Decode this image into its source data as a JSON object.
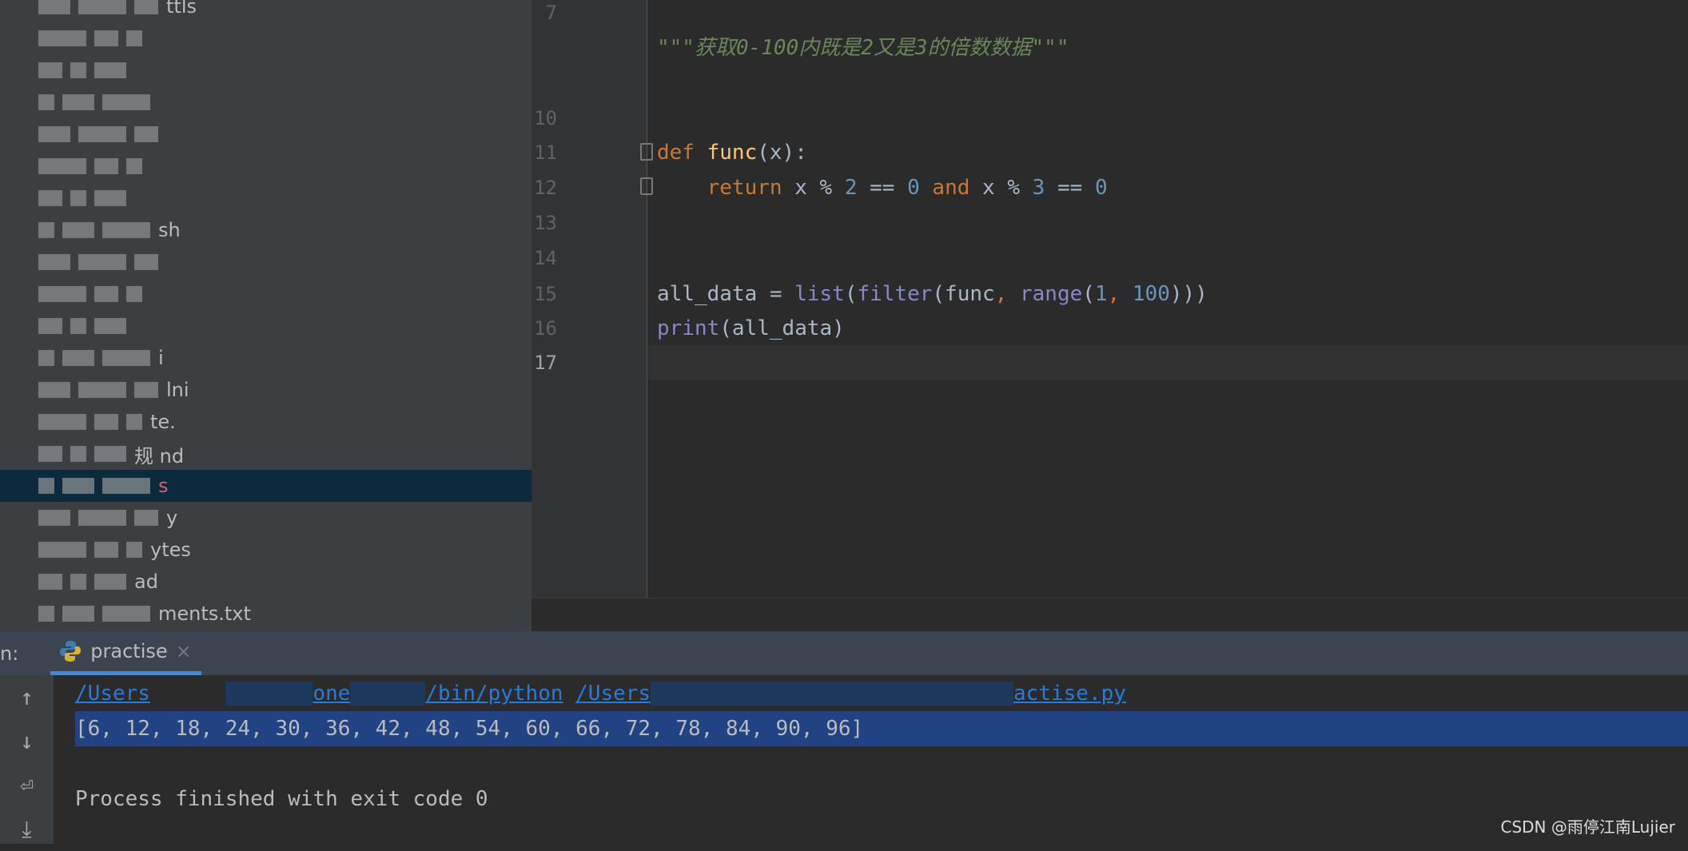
{
  "sidebar": {
    "items": [
      {
        "label": "ttls"
      },
      {
        "label": ""
      },
      {
        "label": ""
      },
      {
        "label": ""
      },
      {
        "label": ""
      },
      {
        "label": ""
      },
      {
        "label": ""
      },
      {
        "label": "sh"
      },
      {
        "label": ""
      },
      {
        "label": ""
      },
      {
        "label": ""
      },
      {
        "label": "i"
      },
      {
        "label": "lni"
      },
      {
        "label": "te."
      },
      {
        "label": "规  nd"
      },
      {
        "label": "s"
      },
      {
        "label": "y"
      },
      {
        "label": "ytes"
      },
      {
        "label": "ad"
      },
      {
        "label": "ments.txt"
      }
    ],
    "selected_index": 15
  },
  "editor": {
    "line_numbers": [
      "7",
      "",
      "",
      "10",
      "11",
      "12",
      "13",
      "14",
      "15",
      "16",
      "17"
    ],
    "current_line": "17",
    "docstring": "\"\"\"获取0-100内既是2又是3的倍数数据\"\"\"",
    "lines": {
      "l11": {
        "kw": "def",
        "fn": "func",
        "rest": "(x):"
      },
      "l12": {
        "kw1": "return",
        "a": " x % ",
        "n1": "2",
        "b": " == ",
        "n2": "0",
        "kw2": "and",
        "c": " x % ",
        "n3": "3",
        "d": " == ",
        "n4": "0"
      },
      "l15": {
        "a": "all_data = ",
        "b1": "list",
        "p1": "(",
        "b2": "filter",
        "p2": "(func",
        "comma1": ",",
        "sp": " ",
        "b3": "range",
        "p3": "(",
        "n1": "1",
        "comma2": ",",
        "n2": "100",
        "p4": ")))"
      },
      "l16": {
        "b": "print",
        "rest": "(all_data)"
      }
    }
  },
  "run_panel": {
    "label": "n:",
    "tab_label": "practise",
    "close_icon": "×",
    "command": {
      "p1": "/Users",
      "p2": "one",
      "p3": "/bin/python",
      "p4": "/Users",
      "p5": "actise.py"
    },
    "output": "[6, 12, 18, 24, 30, 36, 42, 48, 54, 60, 66, 72, 78, 84, 90, 96]",
    "exit_message": "Process finished with exit code 0"
  },
  "watermark": "CSDN @雨停江南Lujier",
  "colors": {
    "keyword": "#cc7832",
    "function": "#ffc66d",
    "number": "#6897bb",
    "builtin": "#8888c6",
    "string": "#6a8759",
    "selection": "#214283",
    "link": "#287bde"
  }
}
